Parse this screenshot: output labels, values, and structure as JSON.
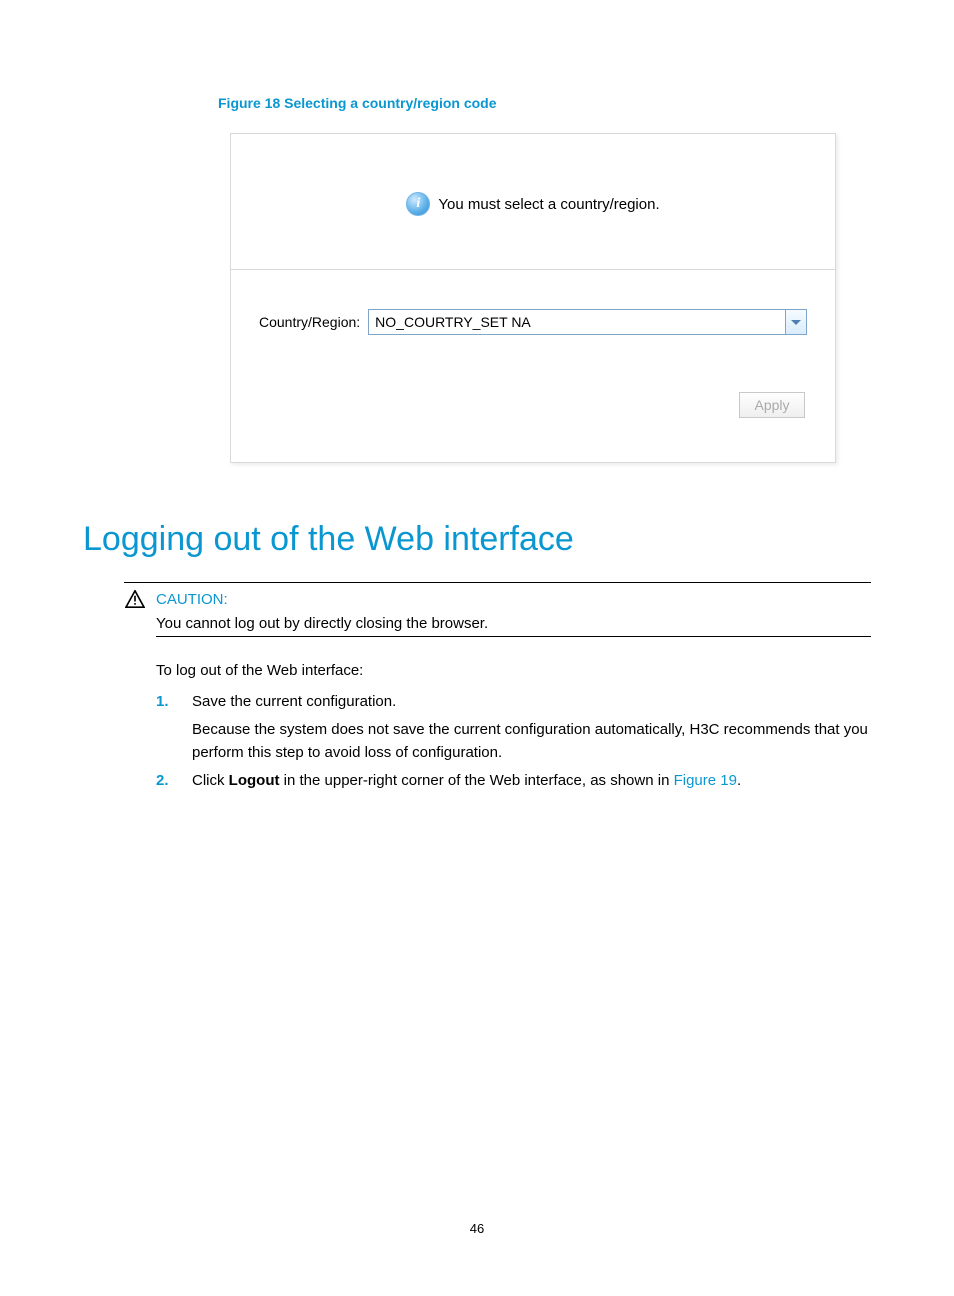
{
  "figure": {
    "caption": "Figure 18 Selecting a country/region code"
  },
  "panel": {
    "info_text": "You must select a country/region.",
    "field_label": "Country/Region:",
    "select_value": "NO_COURTRY_SET NA",
    "apply_label": "Apply"
  },
  "heading": "Logging out of the Web interface",
  "caution": {
    "label": "CAUTION:",
    "text": "You cannot log out by directly closing the browser."
  },
  "body": {
    "intro": "To log out of the Web interface:",
    "steps": [
      {
        "num": "1.",
        "text": "Save the current configuration.",
        "sub": "Because the system does not save the current configuration automatically, H3C recommends that you perform this step to avoid loss of configuration."
      },
      {
        "num": "2.",
        "prefix": "Click ",
        "bold": "Logout",
        "middle": " in the upper-right corner of the Web interface, as shown in ",
        "link": "Figure 19",
        "suffix": "."
      }
    ]
  },
  "page_number": "46"
}
